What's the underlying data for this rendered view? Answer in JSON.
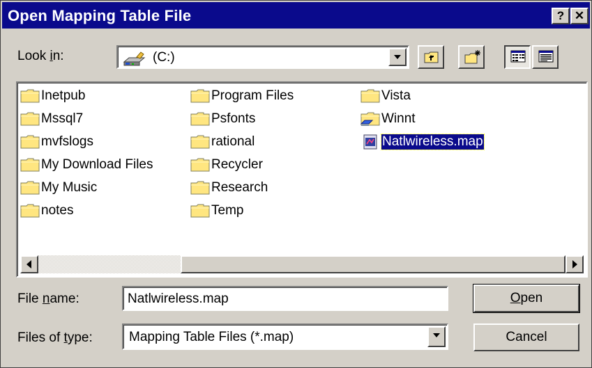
{
  "dialog": {
    "title": "Open Mapping Table File",
    "help_glyph": "?",
    "close_glyph": "✕"
  },
  "look_in": {
    "label_pre": "Look ",
    "label_accel": "i",
    "label_post": "n:",
    "value": "(C:)",
    "drive_icon": "hard-drive-icon"
  },
  "toolbar": {
    "buttons": [
      "up-one-level-icon",
      "create-new-folder-icon",
      "list-view-icon",
      "details-view-icon"
    ]
  },
  "files": {
    "column1": [
      {
        "name": "Inetpub",
        "type": "folder"
      },
      {
        "name": "Mssql7",
        "type": "folder"
      },
      {
        "name": "mvfslogs",
        "type": "folder"
      },
      {
        "name": "My Download Files",
        "type": "folder"
      },
      {
        "name": "My Music",
        "type": "folder"
      },
      {
        "name": "notes",
        "type": "folder"
      }
    ],
    "column2": [
      {
        "name": "Program Files",
        "type": "folder"
      },
      {
        "name": "Psfonts",
        "type": "folder"
      },
      {
        "name": "rational",
        "type": "folder"
      },
      {
        "name": "Recycler",
        "type": "folder"
      },
      {
        "name": "Research",
        "type": "folder"
      },
      {
        "name": "Temp",
        "type": "folder"
      }
    ],
    "column3": [
      {
        "name": "Vista",
        "type": "folder"
      },
      {
        "name": "Winnt",
        "type": "shared-folder"
      },
      {
        "name": "Natlwireless.map",
        "type": "map-file",
        "selected": true
      }
    ]
  },
  "file_name": {
    "label_pre": "File ",
    "label_accel": "n",
    "label_post": "ame:",
    "value": "Natlwireless.map"
  },
  "file_type": {
    "label_pre": "Files of ",
    "label_accel": "t",
    "label_post": "ype:",
    "value": "Mapping Table Files (*.map)"
  },
  "buttons": {
    "open_accel": "O",
    "open_rest": "pen",
    "cancel": "Cancel"
  },
  "colors": {
    "titlebar": "#0a0a8c",
    "face": "#d4d0c8",
    "folder": "#ffe680",
    "selection": "#0a0a8c"
  }
}
